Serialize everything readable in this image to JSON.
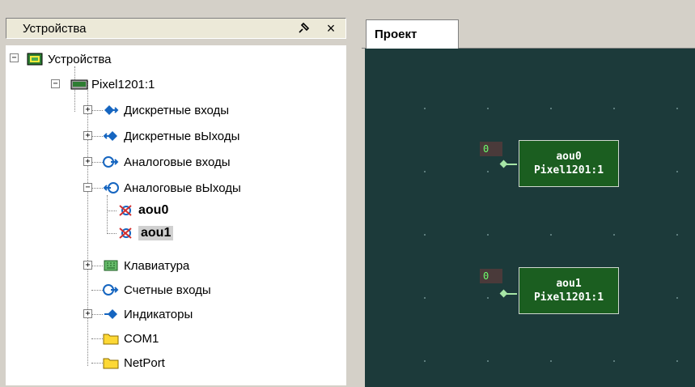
{
  "devices_panel": {
    "title": "Устройства",
    "pin_icon": "pin-icon",
    "close_label": "×"
  },
  "tree": {
    "root": "Устройства",
    "device": "Pixel1201:1",
    "items": [
      {
        "label": "Дискретные входы",
        "icon": "digital-input-icon",
        "expander": "+"
      },
      {
        "label": "Дискретные вЫходы",
        "icon": "digital-output-icon",
        "expander": "+"
      },
      {
        "label": "Аналоговые входы",
        "icon": "analog-input-icon",
        "expander": "+"
      },
      {
        "label": "Аналоговые вЫходы",
        "icon": "analog-output-icon",
        "expander": "−"
      },
      {
        "label": "Клавиатура",
        "icon": "keyboard-icon",
        "expander": "+"
      },
      {
        "label": "Счетные входы",
        "icon": "counter-input-icon",
        "expander": ""
      },
      {
        "label": "Индикаторы",
        "icon": "indicator-icon",
        "expander": "+"
      },
      {
        "label": "COM1",
        "icon": "folder-icon",
        "expander": ""
      },
      {
        "label": "NetPort",
        "icon": "folder-icon",
        "expander": ""
      }
    ],
    "outputs": [
      {
        "label": "aou0",
        "selected": false
      },
      {
        "label": "aou1",
        "selected": true
      }
    ]
  },
  "project_tab": {
    "label": "Проект"
  },
  "canvas": {
    "blocks": [
      {
        "name": "aou0",
        "device": "Pixel1201:1",
        "value": "0"
      },
      {
        "name": "aou1",
        "device": "Pixel1201:1",
        "value": "0"
      }
    ]
  },
  "colors": {
    "canvas_bg": "#1c3a3a",
    "block_bg": "#1b5e20",
    "value_text": "#6cff6c"
  }
}
